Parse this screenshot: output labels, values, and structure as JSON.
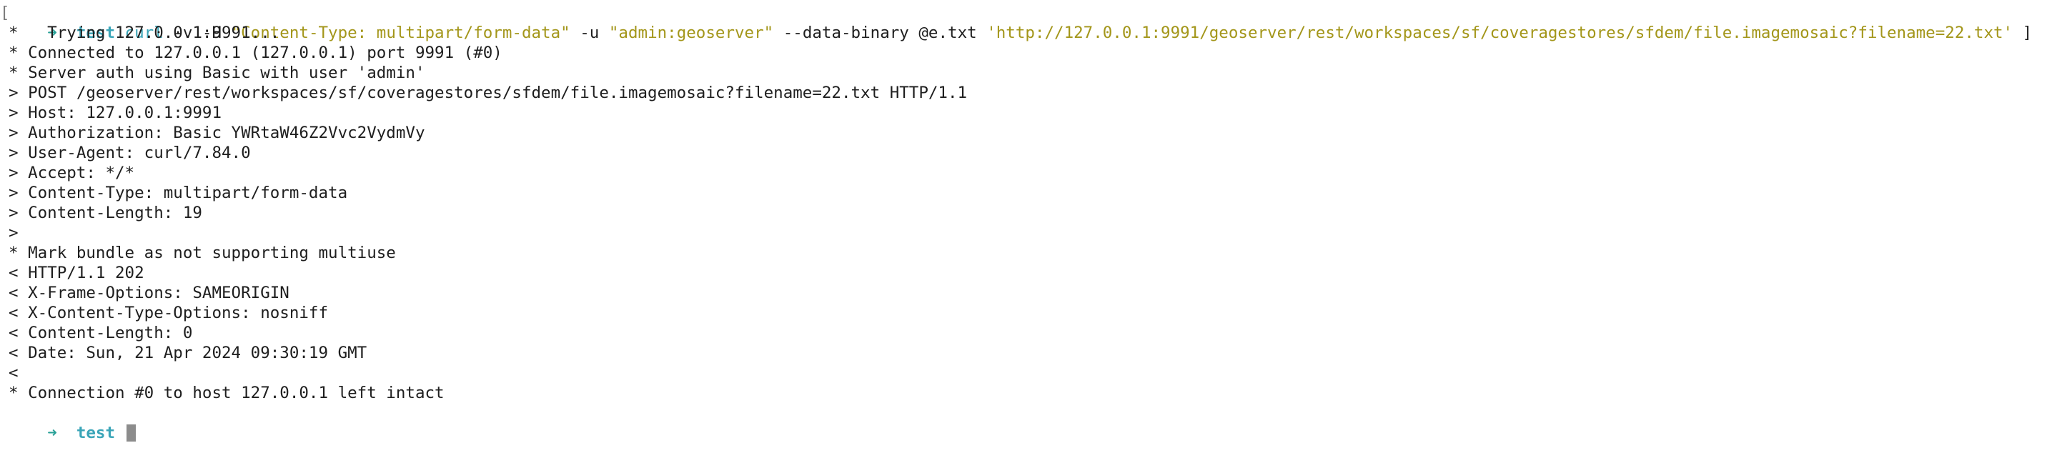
{
  "prompt": {
    "symbol": "➜",
    "cwd": "test"
  },
  "command": {
    "program": "curl",
    "args1": " -v -H ",
    "header": "\"Content-Type: multipart/form-data\"",
    "args2": " -u ",
    "credentials": "\"admin:geoserver\"",
    "args3": " --data-binary @e.txt ",
    "url": "'http://127.0.0.1:9991/geoserver/rest/workspaces/sf/coveragestores/sfdem/file.imagemosaic?filename=22.txt'",
    "trailing_bracket": "]"
  },
  "output": [
    "*   Trying 127.0.0.1:9991...",
    "* Connected to 127.0.0.1 (127.0.0.1) port 9991 (#0)",
    "* Server auth using Basic with user 'admin'",
    "> POST /geoserver/rest/workspaces/sf/coveragestores/sfdem/file.imagemosaic?filename=22.txt HTTP/1.1",
    "> Host: 127.0.0.1:9991",
    "> Authorization: Basic YWRtaW46Z2Vvc2VydmVy",
    "> User-Agent: curl/7.84.0",
    "> Accept: */*",
    "> Content-Type: multipart/form-data",
    "> Content-Length: 19",
    ">",
    "* Mark bundle as not supporting multiuse",
    "< HTTP/1.1 202",
    "< X-Frame-Options: SAMEORIGIN",
    "< X-Content-Type-Options: nosniff",
    "< Content-Length: 0",
    "< Date: Sun, 21 Apr 2024 09:30:19 GMT",
    "<",
    "* Connection #0 to host 127.0.0.1 left intact"
  ],
  "final_prompt": {
    "symbol": "➜",
    "cwd": "test"
  },
  "colors": {
    "background": "#ffffff",
    "text": "#1e1e1e",
    "prompt_arrow": "#2aa198",
    "cwd": "#3aa5b8",
    "string": "#a3961a",
    "cursor": "#8c8c8c"
  }
}
